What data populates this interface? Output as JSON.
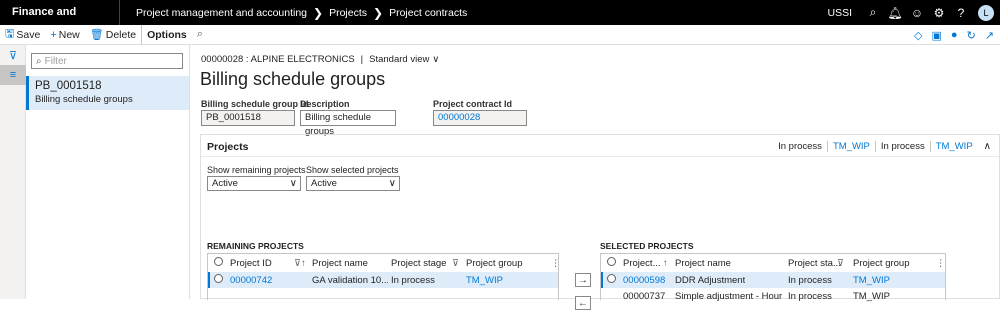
{
  "topbar": {
    "app_title": "Finance and Operations",
    "breadcrumb": [
      "Project management and accounting",
      "Projects",
      "Project contracts"
    ],
    "company": "USSI",
    "avatar_initial": "L"
  },
  "actionbar": {
    "save": "Save",
    "new": "New",
    "delete": "Delete",
    "options": "Options"
  },
  "list": {
    "filter_placeholder": "Filter",
    "items": [
      {
        "id": "PB_0001518",
        "desc": "Billing schedule groups"
      }
    ]
  },
  "record": {
    "contract": "00000028 : ALPINE ELECTRONICS",
    "view": "Standard view",
    "title": "Billing schedule groups"
  },
  "fields": {
    "group_id": {
      "label": "Billing schedule group Id",
      "value": "PB_0001518"
    },
    "description": {
      "label": "Description",
      "value": "Billing schedule groups"
    },
    "contract_id": {
      "label": "Project contract Id",
      "value": "00000028"
    }
  },
  "projects_tab": {
    "title": "Projects",
    "summary": [
      "In process",
      "TM_WIP",
      "In process",
      "TM_WIP"
    ],
    "show_remaining": {
      "label": "Show remaining projects",
      "value": "Active"
    },
    "show_selected": {
      "label": "Show selected projects",
      "value": "Active"
    }
  },
  "remaining": {
    "title": "REMAINING PROJECTS",
    "headers": {
      "id": "Project ID",
      "name": "Project name",
      "stage": "Project stage",
      "group": "Project group"
    },
    "rows": [
      {
        "id": "00000742",
        "name": "GA validation 10....",
        "stage": "In process",
        "group": "TM_WIP"
      }
    ]
  },
  "selected": {
    "title": "SELECTED PROJECTS",
    "headers": {
      "id": "Project...",
      "name": "Project name",
      "stage": "Project sta...",
      "group": "Project group"
    },
    "rows": [
      {
        "id": "00000598",
        "name": "DDR Adjustment",
        "stage": "In process",
        "group": "TM_WIP"
      },
      {
        "id": "00000737",
        "name": "Simple adjustment - Hour",
        "stage": "In process",
        "group": "TM_WIP"
      }
    ]
  },
  "colors": {
    "accent": "#0078d4",
    "selected_row": "#deecf9",
    "topbar": "#000000"
  }
}
